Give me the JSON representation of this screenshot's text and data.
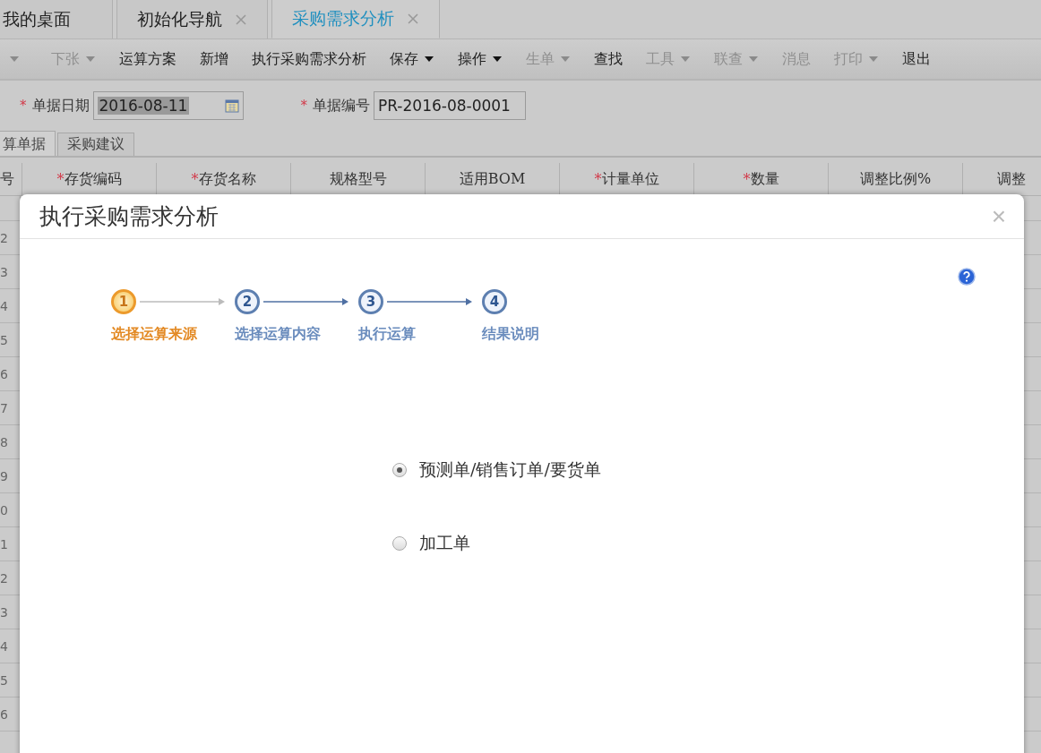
{
  "tabs": [
    {
      "label": "我的桌面",
      "selected": false,
      "closable": false
    },
    {
      "label": "初始化导航",
      "selected": false,
      "closable": true
    },
    {
      "label": "采购需求分析",
      "selected": true,
      "closable": true
    }
  ],
  "toolbar": [
    {
      "label": "下张",
      "disabled": true,
      "dropdown": true
    },
    {
      "label": "运算方案",
      "disabled": false,
      "dropdown": false
    },
    {
      "label": "新增",
      "disabled": false,
      "dropdown": false
    },
    {
      "label": "执行采购需求分析",
      "disabled": false,
      "dropdown": false
    },
    {
      "label": "保存",
      "disabled": false,
      "dropdown": true
    },
    {
      "label": "操作",
      "disabled": false,
      "dropdown": true
    },
    {
      "label": "生单",
      "disabled": true,
      "dropdown": true
    },
    {
      "label": "查找",
      "disabled": false,
      "dropdown": false
    },
    {
      "label": "工具",
      "disabled": true,
      "dropdown": true
    },
    {
      "label": "联查",
      "disabled": true,
      "dropdown": true
    },
    {
      "label": "消息",
      "disabled": true,
      "dropdown": false
    },
    {
      "label": "打印",
      "disabled": true,
      "dropdown": true
    },
    {
      "label": "退出",
      "disabled": false,
      "dropdown": false
    }
  ],
  "form": [
    {
      "label": "单据日期",
      "required_mark": "*",
      "value": "2016-08-11",
      "kind": "date"
    },
    {
      "label": "单据编号",
      "required_mark": "*",
      "value": "PR-2016-08-0001",
      "kind": "text"
    }
  ],
  "subtabs": [
    {
      "label": "算单据",
      "selected": true
    },
    {
      "label": "采购建议",
      "selected": false
    }
  ],
  "table": {
    "columns": [
      {
        "label": "号"
      },
      {
        "label": "存货编码",
        "required_mark": "*"
      },
      {
        "label": "存货名称",
        "required_mark": "*"
      },
      {
        "label": "规格型号"
      },
      {
        "label": "适用BOM"
      },
      {
        "label": "计量单位",
        "required_mark": "*"
      },
      {
        "label": "数量",
        "required_mark": "*"
      },
      {
        "label": "调整比例%"
      },
      {
        "label": "调整"
      }
    ],
    "row_numbers": [
      "2",
      "3",
      "4",
      "5",
      "6",
      "7",
      "8",
      "9",
      "0",
      "1",
      "2",
      "3",
      "4",
      "5",
      "6"
    ]
  },
  "dialog": {
    "title": "执行采购需求分析",
    "close": "×",
    "steps": [
      {
        "number": "1",
        "label": "选择运算来源",
        "selected": true
      },
      {
        "number": "2",
        "label": "选择运算内容",
        "selected": false
      },
      {
        "number": "3",
        "label": "执行运算",
        "selected": false
      },
      {
        "number": "4",
        "label": "结果说明",
        "selected": false
      }
    ],
    "options": [
      {
        "label": "预测单/销售订单/要货单",
        "selected": true
      },
      {
        "label": "加工单",
        "selected": false
      }
    ]
  }
}
